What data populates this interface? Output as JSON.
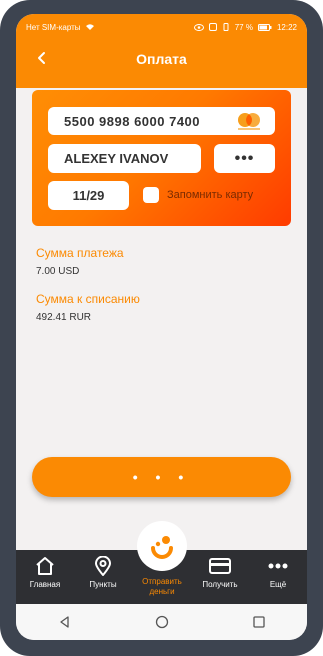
{
  "status_bar": {
    "left_text": "Нет SIM-карты",
    "battery": "77 %",
    "time": "12:22"
  },
  "header": {
    "title": "Оплата"
  },
  "card_form": {
    "card_number": "5500 9898  6000 7400",
    "card_brand": "mastercard",
    "holder_name": "ALEXEY IVANOV",
    "cvv_masked": "•••",
    "expiry": "11/29",
    "remember_label": "Запомнить карту",
    "remember_checked": false
  },
  "payment_info": {
    "amount_label": "Сумма платежа",
    "amount_value": "7.00 USD",
    "debit_label": "Сумма к списанию",
    "debit_value": "492.41 RUR"
  },
  "pay_button": {
    "label": "• • •"
  },
  "tab_bar": {
    "items": [
      {
        "label": "Главная",
        "icon": "home-icon"
      },
      {
        "label": "Пункты",
        "icon": "location-pin-icon"
      },
      {
        "label": "Отправить деньги",
        "icon": "send-money-icon",
        "active": true
      },
      {
        "label": "Получить",
        "icon": "card-icon"
      },
      {
        "label": "Ещё",
        "icon": "more-dots-icon"
      }
    ]
  },
  "colors": {
    "accent": "#fb8a03",
    "tab_bar_bg": "#2e2f33",
    "screen_bg": "#f3f1f1"
  }
}
